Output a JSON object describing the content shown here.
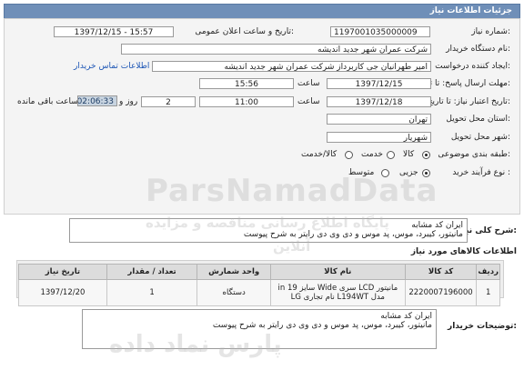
{
  "header": {
    "title": "جزئیات اطلاعات نیاز"
  },
  "form": {
    "need_number": {
      "label": "شماره نیاز:",
      "value": "1197001035000009"
    },
    "announce_date": {
      "label": "تاریخ و ساعت اعلان عمومی:",
      "value": "1397/12/15 - 15:57"
    },
    "buyer_org": {
      "label": "نام دستگاه خریدار:",
      "value": "شرکت عمران شهر جدید اندیشه"
    },
    "requester": {
      "label": "ایجاد کننده درخواست:",
      "value": "امیر طهرانیان جی کاربرداز شرکت عمران شهر جدید اندیشه",
      "contact_link": "اطلاعات تماس خریدار"
    },
    "response_deadline": {
      "label": "مهلت ارسال پاسخ: تا تاریخ:",
      "date": "1397/12/15",
      "time_label": "ساعت",
      "time": "15:56"
    },
    "validity": {
      "label": "تاریخ اعتبار نیاز: تا تاریخ:",
      "date": "1397/12/18",
      "time_label": "ساعت",
      "time": "11:00",
      "days": "2",
      "days_label": "روز و",
      "remaining": "02:06:33",
      "remaining_label": "ساعت باقی مانده"
    },
    "province": {
      "label": "استان محل تحویل:",
      "value": "تهران"
    },
    "city": {
      "label": "شهر محل تحویل:",
      "value": "شهریار"
    },
    "category": {
      "label": "طبقه بندی موضوعی:",
      "options": [
        "کالا",
        "خدمت",
        "کالا/خدمت"
      ],
      "selected": "کالا"
    },
    "process": {
      "label": "نوع فرآیند خرید :",
      "options": [
        "جزیی",
        "متوسط"
      ],
      "selected": "جزیی"
    }
  },
  "summary": {
    "label": "شرح کلی نیاز:",
    "line1": "ایران کد مشابه",
    "line2": "مانیتور، کیبرد، موس، پد موس و دی وی دی رایتر به شرح پیوست"
  },
  "items_section": {
    "title": "اطلاعات کالاهای مورد نیاز",
    "columns": [
      "ردیف",
      "کد کالا",
      "نام کالا",
      "واحد شمارش",
      "تعداد / مقدار",
      "تاریخ نیاز"
    ],
    "rows": [
      {
        "row": "1",
        "code": "2220007196000",
        "name": "مانیتور LCD سری Wide سایز 19 in مدل L194WT نام تجاری LG",
        "unit": "دستگاه",
        "qty": "1",
        "date": "1397/12/20"
      }
    ]
  },
  "buyer_notes": {
    "label": "توضیحات خریدار:",
    "line1": "ایران کد مشابه",
    "line2": "مانیتور، کیبرد، موس، پد موس و دی وی دی رایتر به شرح پیوست"
  },
  "watermark": {
    "brand": "ParsNamadData",
    "line1": "پایگاه اطلاع رسانی مناقصه و مزایده",
    "line2": "آنلاین",
    "line3": "پارس نماد داده"
  }
}
